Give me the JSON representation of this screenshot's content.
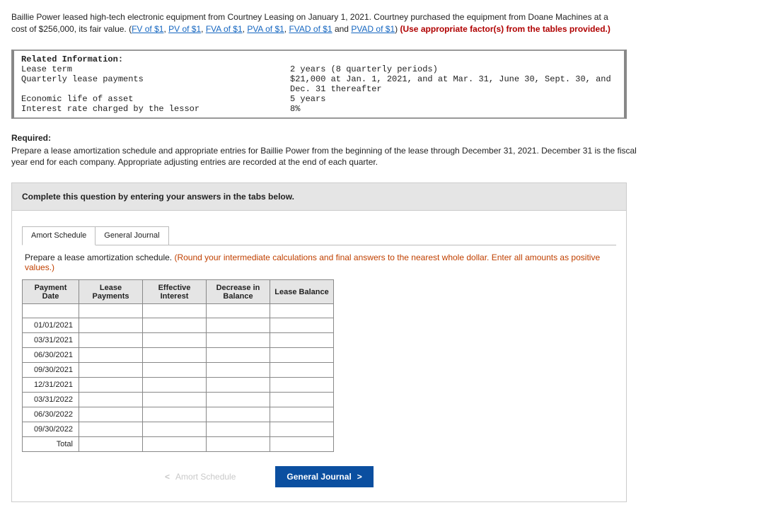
{
  "intro": {
    "text_a": "Baillie Power leased high-tech electronic equipment from Courtney Leasing on January 1, 2021. Courtney purchased the equipment from Doane Machines at a cost of $256,000, its fair value. (",
    "links": [
      "FV of $1",
      "PV of $1",
      "FVA of $1",
      "PVA of $1",
      "FVAD of $1",
      "PVAD of $1"
    ],
    "text_b": " and ",
    "text_c": ") ",
    "bold_red": "(Use appropriate factor(s) from the tables provided.)"
  },
  "info": {
    "title": "Related Information:",
    "rows": [
      {
        "label": "Lease term",
        "value": "2 years (8 quarterly periods)"
      },
      {
        "label": "Quarterly lease payments",
        "value": "$21,000 at Jan. 1, 2021, and at Mar. 31, June 30, Sept. 30, and Dec. 31 thereafter"
      },
      {
        "label": "Economic life of asset",
        "value": "5 years"
      },
      {
        "label": "Interest rate charged by the lessor",
        "value": "8%"
      }
    ]
  },
  "required": {
    "heading": "Required:",
    "body": "Prepare a lease amortization schedule and appropriate entries for Baillie Power from the beginning of the lease through December 31, 2021. December 31 is the fiscal year end for each company. Appropriate adjusting entries are recorded at the end of each quarter."
  },
  "complete_bar": "Complete this question by entering your answers in the tabs below.",
  "tabs": {
    "amort": "Amort Schedule",
    "journal": "General Journal"
  },
  "tab_instruction": {
    "main": "Prepare a lease amortization schedule. ",
    "note": "(Round your intermediate calculations and final answers to the nearest whole dollar. Enter all amounts as positive values.)"
  },
  "table": {
    "headers": [
      "Payment Date",
      "Lease Payments",
      "Effective Interest",
      "Decrease in Balance",
      "Lease Balance"
    ],
    "dates": [
      "01/01/2021",
      "03/31/2021",
      "06/30/2021",
      "09/30/2021",
      "12/31/2021",
      "03/31/2022",
      "06/30/2022",
      "09/30/2022",
      "Total"
    ]
  },
  "nav": {
    "prev": "Amort Schedule",
    "next": "General Journal"
  }
}
